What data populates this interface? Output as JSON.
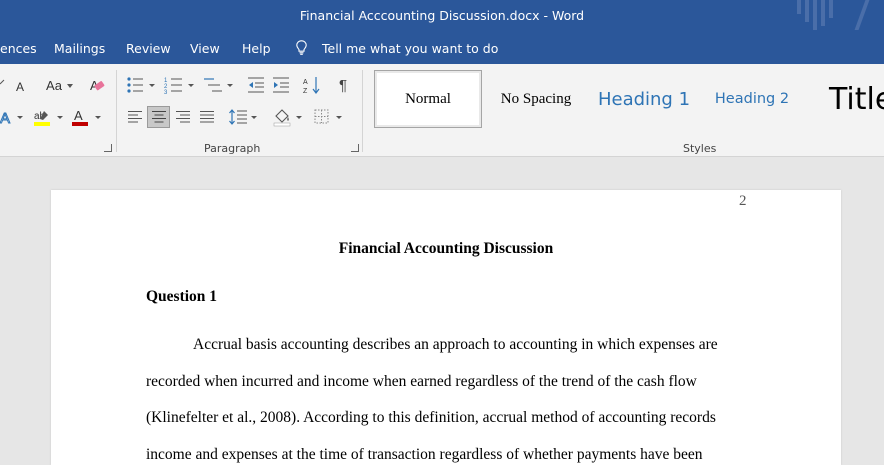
{
  "window": {
    "title": "Financial Acccounting Discussion.docx  -  Word"
  },
  "menu": {
    "tabs": [
      "ences",
      "Mailings",
      "Review",
      "View",
      "Help"
    ],
    "tell_me": "Tell me what you want to do"
  },
  "ribbon": {
    "font_case_label": "Aa",
    "paragraph_group_label": "Paragraph",
    "styles_group_label": "Styles",
    "styles": [
      "Normal",
      "No Spacing",
      "Heading 1",
      "Heading 2",
      "Title"
    ],
    "selected_style": "Normal",
    "selected_alignment": "center"
  },
  "document": {
    "page_number": "2",
    "title": "Financial Accounting Discussion",
    "question_heading": "Question 1",
    "paragraph_lines": [
      "Accrual basis accounting describes an approach to accounting in which expenses are",
      "recorded when incurred and income when earned regardless of the trend of the cash flow",
      "(Klinefelter et al., 2008). According to this definition, accrual method of accounting records",
      "income and expenses at the time of transaction regardless of whether payments have been"
    ]
  },
  "colors": {
    "title_bar": "#2b579a",
    "ribbon_bg": "#f3f3f3",
    "heading_blue": "#2e74b5",
    "font_color_red": "#c00000",
    "highlight_yellow": "#ffff00"
  }
}
